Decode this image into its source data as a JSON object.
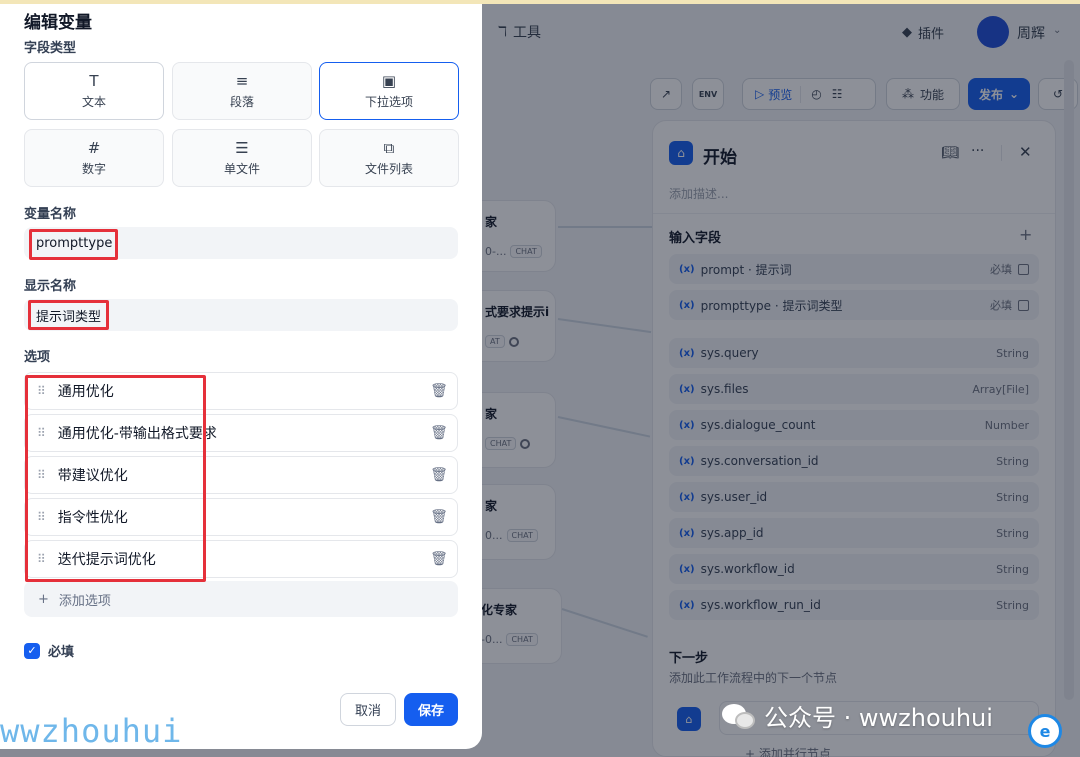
{
  "topnav": {
    "tools_label": "工具",
    "plugin_label": "插件",
    "user_name": "周辉"
  },
  "toolbar": {
    "env_label": "ENV",
    "preview_label": "预览",
    "features_label": "功能",
    "publish_label": "发布"
  },
  "canvas_nodes": [
    {
      "title": "家",
      "sub": "0-...",
      "tag": "CHAT"
    },
    {
      "title": "式要求提示i",
      "sub": "AT",
      "tag": ""
    },
    {
      "title": "家",
      "sub": "",
      "tag": "CHAT"
    },
    {
      "title": "家",
      "sub": "0...",
      "tag": "CHAT"
    },
    {
      "title": "化专家",
      "sub": "-0...",
      "tag": "CHAT"
    }
  ],
  "start_panel": {
    "title": "开始",
    "description_placeholder": "添加描述...",
    "input_fields_label": "输入字段",
    "fields": [
      {
        "name": "prompt · 提示词",
        "right": "必填"
      },
      {
        "name": "prompttype · 提示词类型",
        "right": "必填"
      },
      {
        "name": "sys.query",
        "right": "String"
      },
      {
        "name": "sys.files",
        "right": "Array[File]"
      },
      {
        "name": "sys.dialogue_count",
        "right": "Number"
      },
      {
        "name": "sys.conversation_id",
        "right": "String"
      },
      {
        "name": "sys.user_id",
        "right": "String"
      },
      {
        "name": "sys.app_id",
        "right": "String"
      },
      {
        "name": "sys.workflow_id",
        "right": "String"
      },
      {
        "name": "sys.workflow_run_id",
        "right": "String"
      }
    ],
    "next_step_label": "下一步",
    "next_step_desc": "添加此工作流程中的下一个节点",
    "add_parallel_label": "添加并行节点",
    "fx_label": "(x)"
  },
  "modal": {
    "title": "编辑变量",
    "field_type_label": "字段类型",
    "field_types": [
      {
        "label": "文本",
        "icon": "T"
      },
      {
        "label": "段落",
        "icon": "≡"
      },
      {
        "label": "下拉选项",
        "icon": "▣"
      },
      {
        "label": "数字",
        "icon": "#"
      },
      {
        "label": "单文件",
        "icon": "☰"
      },
      {
        "label": "文件列表",
        "icon": "⧉"
      }
    ],
    "selected_type": "下拉选项",
    "var_name_label": "变量名称",
    "var_name_value": "prompttype",
    "display_name_label": "显示名称",
    "display_name_value": "提示词类型",
    "options_label": "选项",
    "options": [
      "通用优化",
      "通用优化-带输出格式要求",
      "带建议优化",
      "指令性优化",
      "迭代提示词优化"
    ],
    "add_option_label": "添加选项",
    "required_label": "必填",
    "required_checked": true,
    "cancel_label": "取消",
    "save_label": "保存"
  },
  "watermark": {
    "left": "wwzhouhui",
    "right": "公众号 · wwzhouhui"
  },
  "colors": {
    "accent": "#155eef",
    "annotation_red": "#e5303a"
  }
}
